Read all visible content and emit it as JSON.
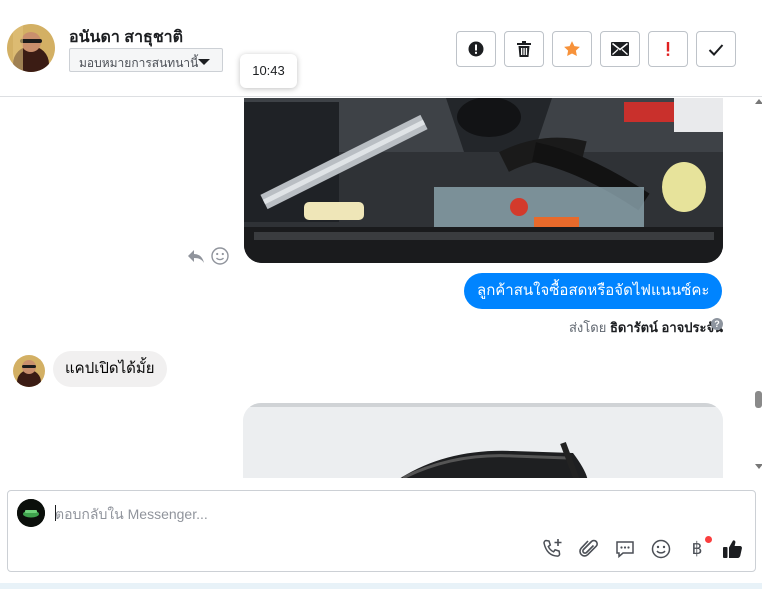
{
  "header": {
    "contact_name": "อนันดา สาธุชาติ",
    "assign_label": "มอบหมายการสนทนานี้",
    "timestamp_tooltip": "10:43",
    "toolbar_icons": [
      "spam-icon",
      "trash-icon",
      "star-icon",
      "mail-icon",
      "important-icon",
      "check-icon"
    ]
  },
  "chat": {
    "outgoing_message": "ลูกค้าสนใจซื้อสดหรือจัดไฟแนนซ์คะ",
    "sent_by_prefix": "ส่งโดย",
    "sent_by_name": "ธิดารัตน์ อาจประจัน",
    "incoming_message": "แคปเปิดได้มั้ย",
    "images": [
      "engine-bay-photo",
      "vehicle-roof-rack-photo"
    ]
  },
  "composer": {
    "placeholder": "ตอบกลับใน Messenger...",
    "icons": [
      "call-icon",
      "attachment-icon",
      "saved-replies-icon",
      "emoji-icon",
      "payment-icon",
      "like-icon"
    ]
  },
  "colors": {
    "accent": "#0084ff",
    "star": "#f7923a",
    "important": "#e02020",
    "incoming_bubble": "#f1f0f0"
  }
}
